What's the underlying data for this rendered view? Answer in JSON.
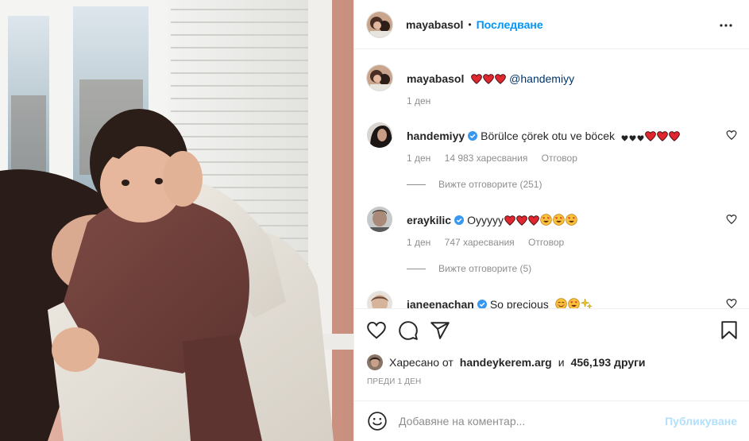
{
  "colors": {
    "accent": "#0095f6",
    "heart": "#ed4956",
    "text": "#262626",
    "muted": "#8e8e8e",
    "post_disabled": "#b2dffc"
  },
  "header": {
    "username": "mayabasol",
    "separator": "•",
    "follow_label": "Последване",
    "more_icon": "more-horizontal-icon"
  },
  "caption": {
    "user": "mayabasol",
    "mention": "@handemiyy",
    "emojis": [
      "red-heart",
      "red-heart",
      "red-heart"
    ],
    "time": "1 ден"
  },
  "comments": [
    {
      "user": "handemiyy",
      "verified": true,
      "text": "Börülce çörek otu ve böcek",
      "emojis": [
        "black-heart",
        "black-heart",
        "black-heart",
        "red-heart",
        "red-heart",
        "red-heart"
      ],
      "time": "1 ден",
      "likes": "14 983 харесвания",
      "reply_label": "Отговор",
      "view_replies": "Вижте отговорите (251)"
    },
    {
      "user": "eraykilic",
      "verified": true,
      "text": "Oyyyyy",
      "emojis": [
        "red-heart",
        "red-heart",
        "red-heart",
        "heart-eyes",
        "heart-eyes",
        "heart-eyes"
      ],
      "time": "1 ден",
      "likes": "747 харесвания",
      "reply_label": "Отговор",
      "view_replies": "Вижте отговорите (5)"
    },
    {
      "user": "janeenachan",
      "verified": true,
      "text": "So precious",
      "emojis": [
        "smiling-face",
        "heart-eyes",
        "sparkles"
      ]
    }
  ],
  "actions": {
    "like_icon": "heart-outline-icon",
    "comment_icon": "comment-icon",
    "share_icon": "paper-plane-icon",
    "save_icon": "bookmark-icon"
  },
  "likes": {
    "prefix": "Харесано от",
    "user": "handeykerem.arg",
    "conj": "и",
    "count": "456,193 други"
  },
  "posted_time": "ПРЕДИ 1 ДЕН",
  "add_comment": {
    "placeholder": "Добавяне на коментар...",
    "post_label": "Публикуване",
    "emoji_icon": "smiley-icon"
  }
}
